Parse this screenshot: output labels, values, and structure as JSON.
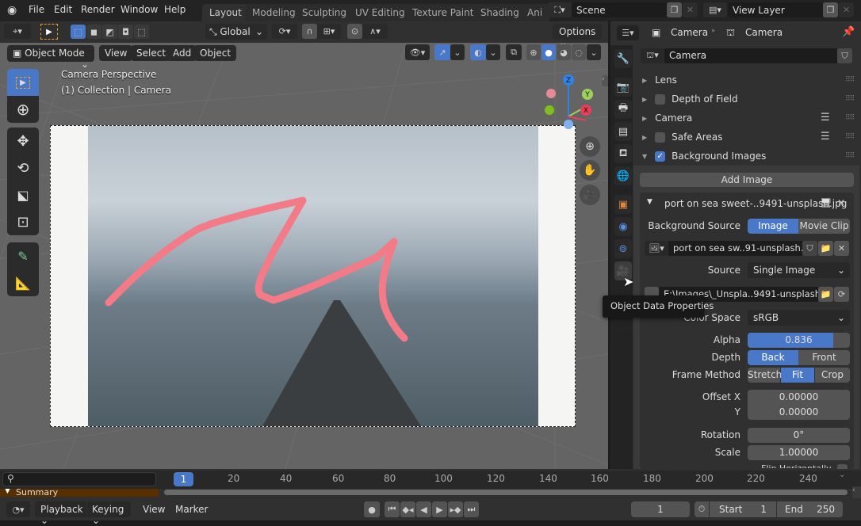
{
  "menubar": {
    "items": [
      "File",
      "Edit",
      "Render",
      "Window",
      "Help"
    ],
    "workspaces": [
      "Layout",
      "Modeling",
      "Sculpting",
      "UV Editing",
      "Texture Paint",
      "Shading",
      "Ani"
    ],
    "scene": "Scene",
    "view_layer": "View Layer"
  },
  "viewport": {
    "transform_orientation": "Global",
    "options_label": "Options",
    "mode": "Object Mode",
    "menus": [
      "View",
      "Select",
      "Add",
      "Object"
    ],
    "overlay_title": "Camera Perspective",
    "overlay_subtitle": "(1) Collection | Camera",
    "gizmo_axes": {
      "z": "Z",
      "y": "Y",
      "x": "X"
    },
    "tools": [
      "select-box",
      "cursor",
      "move",
      "rotate",
      "scale",
      "transform",
      "annotate",
      "measure"
    ],
    "accent": "#4a78c8",
    "annotation_color": "#f27b87"
  },
  "properties": {
    "breadcrumb": [
      "Camera",
      "Camera"
    ],
    "datablock_name": "Camera",
    "tabs": [
      "tool",
      "render",
      "output",
      "view-layer",
      "scene",
      "world",
      "object",
      "physics",
      "constraints",
      "object-data"
    ],
    "panels": [
      {
        "label": "Lens",
        "checkbox": null,
        "expanded": false
      },
      {
        "label": "Depth of Field",
        "checkbox": false,
        "expanded": false
      },
      {
        "label": "Camera",
        "checkbox": null,
        "expanded": false,
        "presets": true
      },
      {
        "label": "Safe Areas",
        "checkbox": false,
        "expanded": false,
        "presets": true
      },
      {
        "label": "Background Images",
        "checkbox": true,
        "expanded": true
      }
    ],
    "add_image_label": "Add Image",
    "bg_image": {
      "title": "port on sea sweet-..9491-unsplash.jpg",
      "source_label": "Background Source",
      "source_options": [
        "Image",
        "Movie Clip"
      ],
      "source_selected": "Image",
      "image_name": "port on sea sw..91-unsplash.jpg",
      "source_type_label": "Source",
      "source_type": "Single Image",
      "filepath": "E:\\Images\\_Unspla..9491-unsplash.jpg",
      "color_space_label": "Color Space",
      "color_space": "sRGB",
      "alpha_label": "Alpha",
      "alpha": "0.836",
      "alpha_fraction": 0.836,
      "depth_label": "Depth",
      "depth_options": [
        "Back",
        "Front"
      ],
      "depth_selected": "Back",
      "frame_method_label": "Frame Method",
      "frame_method_options": [
        "Stretch",
        "Fit",
        "Crop"
      ],
      "frame_method_selected": "Fit",
      "offset_x_label": "Offset X",
      "offset_x": "0.00000",
      "offset_y_label": "Y",
      "offset_y": "0.00000",
      "rotation_label": "Rotation",
      "rotation": "0°",
      "scale_label": "Scale",
      "scale": "1.00000",
      "flip_label": "Flip Horizontally"
    },
    "tooltip": "Object Data Properties"
  },
  "timeline": {
    "current_frame_badge": "1",
    "ticks": [
      "20",
      "40",
      "60",
      "80",
      "100",
      "120",
      "140",
      "160",
      "180",
      "200",
      "220",
      "240"
    ],
    "summary_label": "Summary",
    "menus": [
      "Playback",
      "Keying",
      "View",
      "Marker"
    ],
    "current_frame": "1",
    "start_label": "Start",
    "start": "1",
    "end_label": "End",
    "end": "250"
  }
}
